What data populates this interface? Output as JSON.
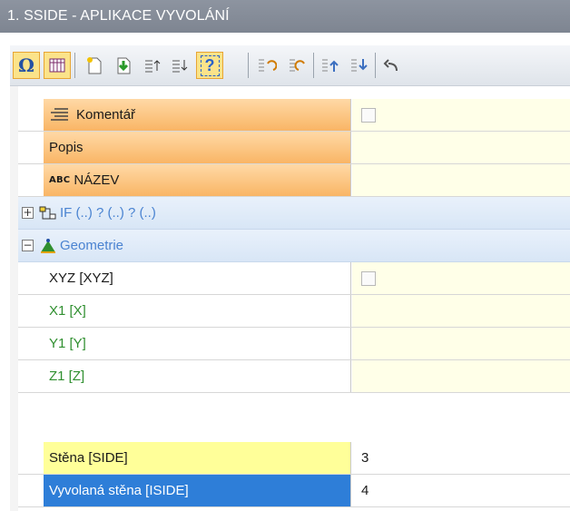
{
  "window": {
    "title": "1. SSIDE - APLIKACE VYVOLÁNÍ"
  },
  "toolbar": {
    "buttons": [
      {
        "name": "omega-icon",
        "glyph": "Ω",
        "active": true
      },
      {
        "name": "grid-icon",
        "active": true
      },
      {
        "name": "new-doc-icon"
      },
      {
        "name": "import-icon"
      },
      {
        "name": "sort-up-icon"
      },
      {
        "name": "sort-down-icon"
      },
      {
        "name": "help-icon",
        "glyph": "?",
        "active": true
      },
      {
        "name": "rotate-left-icon"
      },
      {
        "name": "rotate-right-icon"
      },
      {
        "name": "move-up-icon"
      },
      {
        "name": "move-down-icon"
      },
      {
        "name": "undo-icon"
      }
    ]
  },
  "rows": {
    "komentar": {
      "label": "Komentář"
    },
    "popis": {
      "label": "Popis"
    },
    "nazev": {
      "prefix": "ABC",
      "label": "NÁZEV"
    },
    "if_group": {
      "label": "IF (..) ? (..) ? (..)"
    },
    "geometrie_group": {
      "label": "Geometrie"
    },
    "xyz": {
      "label": "XYZ [XYZ]"
    },
    "x1": {
      "label": "X1 [X]"
    },
    "y1": {
      "label": "Y1 [Y]"
    },
    "z1": {
      "label": "Z1 [Z]"
    },
    "stena": {
      "label": "Stěna [SIDE]",
      "value": "3"
    },
    "vyvolana": {
      "label": "Vyvolaná stěna [ISIDE]",
      "value": "4"
    }
  },
  "colors": {
    "titlebar": "#858c98",
    "orange_label": "#f9b565",
    "yellow_label": "#ffff99",
    "selected_label": "#2e7ed8",
    "value_bg": "#ffffe8",
    "group_text": "#4a83d1",
    "green_text": "#2f8f2f"
  }
}
